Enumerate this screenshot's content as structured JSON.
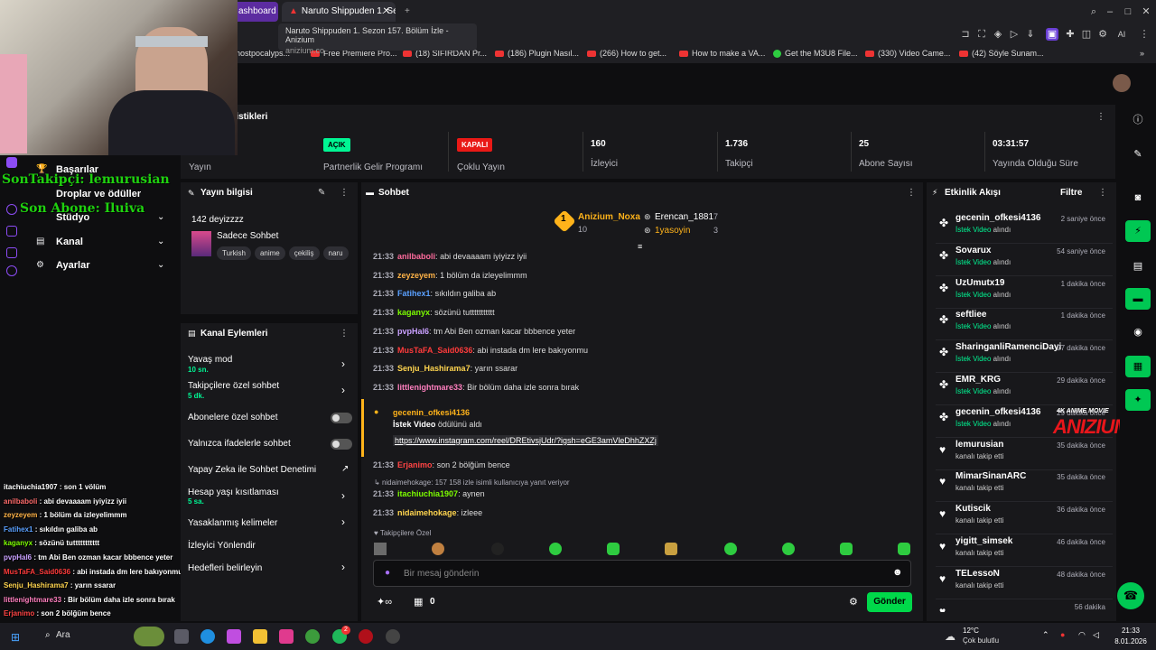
{
  "browser": {
    "tabs": [
      {
        "label": "ashboard"
      },
      {
        "label": "Naruto Shippuden 1. Se"
      }
    ],
    "tooltip": {
      "title": "Naruto Shippuden 1. Sezon 157. Bölüm İzle - Anizium",
      "url": "anizium.co"
    },
    "bookmarks": [
      "Ghostpocalyps...",
      "Free Premiere Pro...",
      "(18) SIFIRDAN Pr...",
      "(186) Plugin Nasıl...",
      "(266) How to get...",
      "How to make a VA...",
      "Get the M3U8 File...",
      "(330) Video Came...",
      "(42) Söyle Sunam..."
    ],
    "toolbar_ai": "AI"
  },
  "stats": {
    "title": "tistikleri",
    "items": [
      {
        "label": "Yayın",
        "value": ""
      },
      {
        "label": "Partnerlik Gelir Programı",
        "badge": "AÇIK",
        "badge_color": "#00f593"
      },
      {
        "label": "Çoklu Yayın",
        "badge": "KAPALI",
        "badge_color": "#e91916"
      },
      {
        "label": "İzleyici",
        "value": "160"
      },
      {
        "label": "Takipçi",
        "value": "1.736"
      },
      {
        "label": "Abone Sayısı",
        "value": "25"
      },
      {
        "label": "Yayında Olduğu Süre",
        "value": "03:31:57"
      }
    ]
  },
  "leftnav": {
    "items": [
      {
        "label": "Başarılar"
      },
      {
        "label": "Droplar ve ödüller"
      },
      {
        "label": "Stüdyo"
      },
      {
        "label": "Kanal"
      },
      {
        "label": "Ayarlar"
      }
    ]
  },
  "overlay": {
    "last_follower": "SonTakipçi: lemurusian",
    "last_sub": "Son Abone: Iluiva",
    "chat": [
      {
        "user": "itachiuchia1907",
        "msg": "son 1 völüm",
        "color": "#ffffff"
      },
      {
        "user": "anilbaboli",
        "msg": "abi devaaaam iyiyizz iyii",
        "color": "#ff6b6b"
      },
      {
        "user": "zeyzeyem",
        "msg": "1 bölüm da izleyelimmm",
        "color": "#ffb347"
      },
      {
        "user": "Fatihex1",
        "msg": "sıkıldın galiba ab",
        "color": "#5aa0ff"
      },
      {
        "user": "kaganyx",
        "msg": "sözünü tuttttttttttt",
        "color": "#7cfc00"
      },
      {
        "user": "pvpHal6",
        "msg": "tm Abi Ben ozman kacar bbbence yeter",
        "color": "#c9a0ff"
      },
      {
        "user": "MusTaFA_Said0636",
        "msg": "abi instada dm lere bakıyonmu",
        "color": "#ff3b3b"
      },
      {
        "user": "Senju_Hashirama7",
        "msg": "yarın ssarar",
        "color": "#ffd54f"
      },
      {
        "user": "littlenightmare33",
        "msg": "Bir bölüm daha izle sonra bırak",
        "color": "#ff7fbf"
      },
      {
        "user": "Erjanimo",
        "msg": "son 2 bölğüm bence",
        "color": "#ff4444"
      },
      {
        "user": "itachiuchia1907",
        "msg": "aynen",
        "color": "#7cfc00"
      },
      {
        "user": "nidaimehokage",
        "msg": "izleee",
        "color": "#ffd54f"
      }
    ],
    "brand": "ANIZIUM",
    "brand_sub": "4K ANIME MOVIE"
  },
  "stream_info": {
    "title": "Yayın bilgisi",
    "stream_title": "142 deyizzzz",
    "category": "Sadece Sohbet",
    "tags": [
      "Turkish",
      "anime",
      "çekiliş",
      "naru"
    ]
  },
  "channel_actions": {
    "title": "Kanal Eylemleri",
    "items": [
      {
        "label": "Yavaş mod",
        "sub": "10 sn.",
        "type": "chevron"
      },
      {
        "label": "Takipçilere özel sohbet",
        "sub": "5 dk.",
        "type": "chevron"
      },
      {
        "label": "Abonelere özel sohbet",
        "sub": "",
        "type": "toggle"
      },
      {
        "label": "Yalnızca ifadelerle sohbet",
        "sub": "",
        "type": "toggle"
      },
      {
        "label": "Yapay Zeka ile Sohbet Denetimi",
        "sub": "",
        "type": "external"
      },
      {
        "label": "Hesap yaşı kısıtlaması",
        "sub": "5 sa.",
        "type": "chevron"
      },
      {
        "label": "Yasaklanmış kelimeler",
        "sub": "",
        "type": "chevron"
      },
      {
        "label": "İzleyici Yönlendir",
        "sub": "",
        "type": "none"
      },
      {
        "label": "Hedefleri belirleyin",
        "sub": "",
        "type": "chevron"
      }
    ]
  },
  "chat": {
    "title": "Sohbet",
    "leaders": [
      {
        "name": "Anizium_Noxa",
        "value": "10",
        "color": "#ffb31a"
      },
      {
        "name": "Erencan_1881",
        "value": "7",
        "color": "#ffffff"
      },
      {
        "name": "1yasoyin",
        "value": "3",
        "color": "#ffb31a"
      }
    ],
    "messages": [
      {
        "time": "21:33",
        "user": "anilbaboli",
        "msg": "abi devaaaam iyiyizz iyii",
        "color": "#ff6b9d"
      },
      {
        "time": "21:33",
        "user": "zeyzeyem",
        "msg": "1 bölüm da izleyelimmm",
        "color": "#ffb347"
      },
      {
        "time": "21:33",
        "user": "Fatihex1",
        "msg": "sıkıldın galiba ab",
        "color": "#5aa0ff"
      },
      {
        "time": "21:33",
        "user": "kaganyx",
        "msg": "sözünü tuttttttttttt",
        "color": "#7cfc00"
      },
      {
        "time": "21:33",
        "user": "pvpHal6",
        "msg": "tm Abi Ben ozman kacar bbbence yeter",
        "color": "#c9a0ff"
      },
      {
        "time": "21:33",
        "user": "MusTaFA_Said0636",
        "msg": "abi instada dm lere bakıyonmu",
        "color": "#ff3b3b"
      },
      {
        "time": "21:33",
        "user": "Senju_Hashirama7",
        "msg": "yarın ssarar",
        "color": "#ffd54f"
      },
      {
        "time": "21:33",
        "user": "littlenightmare33",
        "msg": "Bir bölüm daha izle sonra bırak",
        "color": "#ff7fbf"
      }
    ],
    "redeem": {
      "user": "gecenin_ofkesi4136",
      "action": "İstek Video",
      "suffix": " ödülünü aldı",
      "link": "https://www.instagram.com/reel/DREtivsjUdr/?igsh=eGE3amVleDhhZXZj"
    },
    "messages2": [
      {
        "time": "21:33",
        "user": "Erjanimo",
        "msg": "son 2 bölğüm bence",
        "color": "#ff4444"
      }
    ],
    "reply_note": "nidaimehokage: 157 158 izle isimli kullanıcıya yanıt veriyor",
    "messages3": [
      {
        "time": "21:33",
        "user": "itachiuchia1907",
        "msg": "aynen",
        "color": "#7cfc00"
      },
      {
        "time": "21:33",
        "user": "nidaimehokage",
        "msg": "izleee",
        "color": "#ffd54f"
      }
    ],
    "followers_only": "Takipçilere Özel",
    "input_placeholder": "Bir mesaj gönderin",
    "points": "0",
    "send_label": "Gönder"
  },
  "activity": {
    "title": "Etkinlik Akışı",
    "filter": "Filtre",
    "items": [
      {
        "name": "gecenin_ofkesi4136",
        "desc": "İstek Video",
        "desc2": " alındı",
        "when": "2 saniye önce",
        "kind": "reward"
      },
      {
        "name": "Sovarux",
        "desc": "İstek Video",
        "desc2": " alındı",
        "when": "54 saniye önce",
        "kind": "reward"
      },
      {
        "name": "UzUmutx19",
        "desc": "İstek Video",
        "desc2": " alındı",
        "when": "1 dakika önce",
        "kind": "reward"
      },
      {
        "name": "seftliee",
        "desc": "İstek Video",
        "desc2": " alındı",
        "when": "1 dakika önce",
        "kind": "reward"
      },
      {
        "name": "SharinganliRamenciDayi",
        "desc": "İstek Video",
        "desc2": " alındı",
        "when": "27 dakika önce",
        "kind": "reward"
      },
      {
        "name": "EMR_KRG",
        "desc": "İstek Video",
        "desc2": " alındı",
        "when": "29 dakika önce",
        "kind": "reward"
      },
      {
        "name": "gecenin_ofkesi4136",
        "desc": "İstek Video",
        "desc2": " alındı",
        "when": "29 dakika önce",
        "kind": "reward"
      },
      {
        "name": "lemurusian",
        "desc": "kanalı takip etti",
        "desc2": "",
        "when": "35 dakika önce",
        "kind": "follow"
      },
      {
        "name": "MimarSinanARC",
        "desc": "kanalı takip etti",
        "desc2": "",
        "when": "35 dakika önce",
        "kind": "follow"
      },
      {
        "name": "Kutiscik",
        "desc": "kanalı takip etti",
        "desc2": "",
        "when": "36 dakika önce",
        "kind": "follow"
      },
      {
        "name": "yigitt_simsek",
        "desc": "kanalı takip etti",
        "desc2": "",
        "when": "46 dakika önce",
        "kind": "follow"
      },
      {
        "name": "TELessoN",
        "desc": "kanalı takip etti",
        "desc2": "",
        "when": "48 dakika önce",
        "kind": "follow"
      },
      {
        "name": "",
        "desc": "",
        "desc2": "",
        "when": "56 dakika",
        "kind": "follow"
      }
    ]
  },
  "taskbar": {
    "search": "Ara",
    "weather_temp": "12°C",
    "weather_desc": "Çok bulutlu",
    "time": "21:33",
    "date": "8.01.2026",
    "notif_count": "2"
  }
}
